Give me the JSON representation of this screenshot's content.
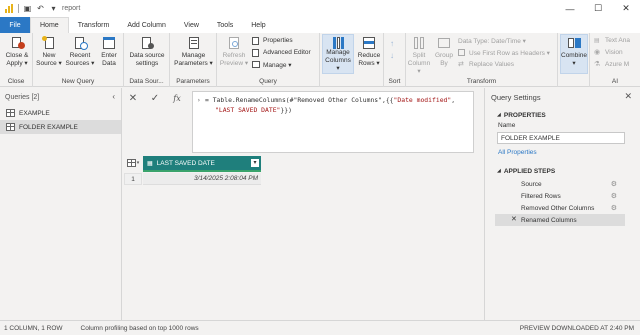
{
  "window": {
    "title": "report",
    "controls": [
      "—",
      "☐",
      "✕"
    ]
  },
  "tabs": [
    "File",
    "Home",
    "Transform",
    "Add Column",
    "View",
    "Tools",
    "Help"
  ],
  "ribbon": {
    "close": {
      "label1": "Close &",
      "label2": "Apply ▾",
      "group": "Close"
    },
    "new_query": {
      "new_source": [
        "New",
        "Source ▾"
      ],
      "recent_sources": [
        "Recent",
        "Sources ▾"
      ],
      "enter_data": [
        "Enter",
        "Data"
      ],
      "group": "New Query"
    },
    "data_sources": {
      "label": [
        "Data source",
        "settings"
      ],
      "group": "Data Sour..."
    },
    "parameters": {
      "label": [
        "Manage",
        "Parameters ▾"
      ],
      "group": "Parameters"
    },
    "query": {
      "refresh": [
        "Refresh",
        "Preview ▾"
      ],
      "properties": "Properties",
      "advanced_editor": "Advanced Editor",
      "manage": "Manage ▾",
      "group": "Query"
    },
    "manage_columns": {
      "label": [
        "Manage",
        "Columns ▾"
      ]
    },
    "reduce_rows": {
      "label": [
        "Reduce",
        "Rows ▾"
      ]
    },
    "sort": {
      "group": "Sort"
    },
    "transform": {
      "split_column": [
        "Split",
        "Column ▾"
      ],
      "group_by": [
        "Group",
        "By"
      ],
      "data_type": "Data Type: Date/Time ▾",
      "first_row": "Use First Row as Headers ▾",
      "replace_values": "Replace Values",
      "group": "Transform"
    },
    "combine": {
      "label": [
        "Combine",
        "▾"
      ]
    },
    "ai": {
      "text_analytics": "Text Ana",
      "vision": "Vision",
      "azure_ml": "Azure M",
      "group": "AI"
    }
  },
  "queries": {
    "header": "Queries [2]",
    "items": [
      "EXAMPLE",
      "FOLDER EXAMPLE"
    ],
    "selected_index": 1
  },
  "formula": {
    "line1_prefix": "= Table.RenameColumns(#\"Removed Other Columns\",{{",
    "line1_str": "\"Date modified\"",
    "line1_sep": ",",
    "line2_str": "\"LAST SAVED DATE\"",
    "line2_suffix": "}})"
  },
  "grid": {
    "column": "LAST SAVED DATE",
    "rows": [
      {
        "num": "1",
        "value": "3/14/2025 2:08:04 PM"
      }
    ]
  },
  "settings": {
    "title": "Query Settings",
    "properties_header": "PROPERTIES",
    "name_label": "Name",
    "name_value": "FOLDER EXAMPLE",
    "all_properties": "All Properties",
    "steps_header": "APPLIED STEPS",
    "steps": [
      "Source",
      "Filtered Rows",
      "Removed Other Columns",
      "Renamed Columns"
    ],
    "selected_step": 3
  },
  "status": {
    "left": "1 COLUMN, 1 ROW",
    "profiling": "Column profiling based on top 1000 rows",
    "right": "PREVIEW DOWNLOADED AT 2:40 PM"
  },
  "colors": {
    "accent": "#2b78c5",
    "column_header": "#1f7f7c",
    "brand": "#e8b31a"
  }
}
